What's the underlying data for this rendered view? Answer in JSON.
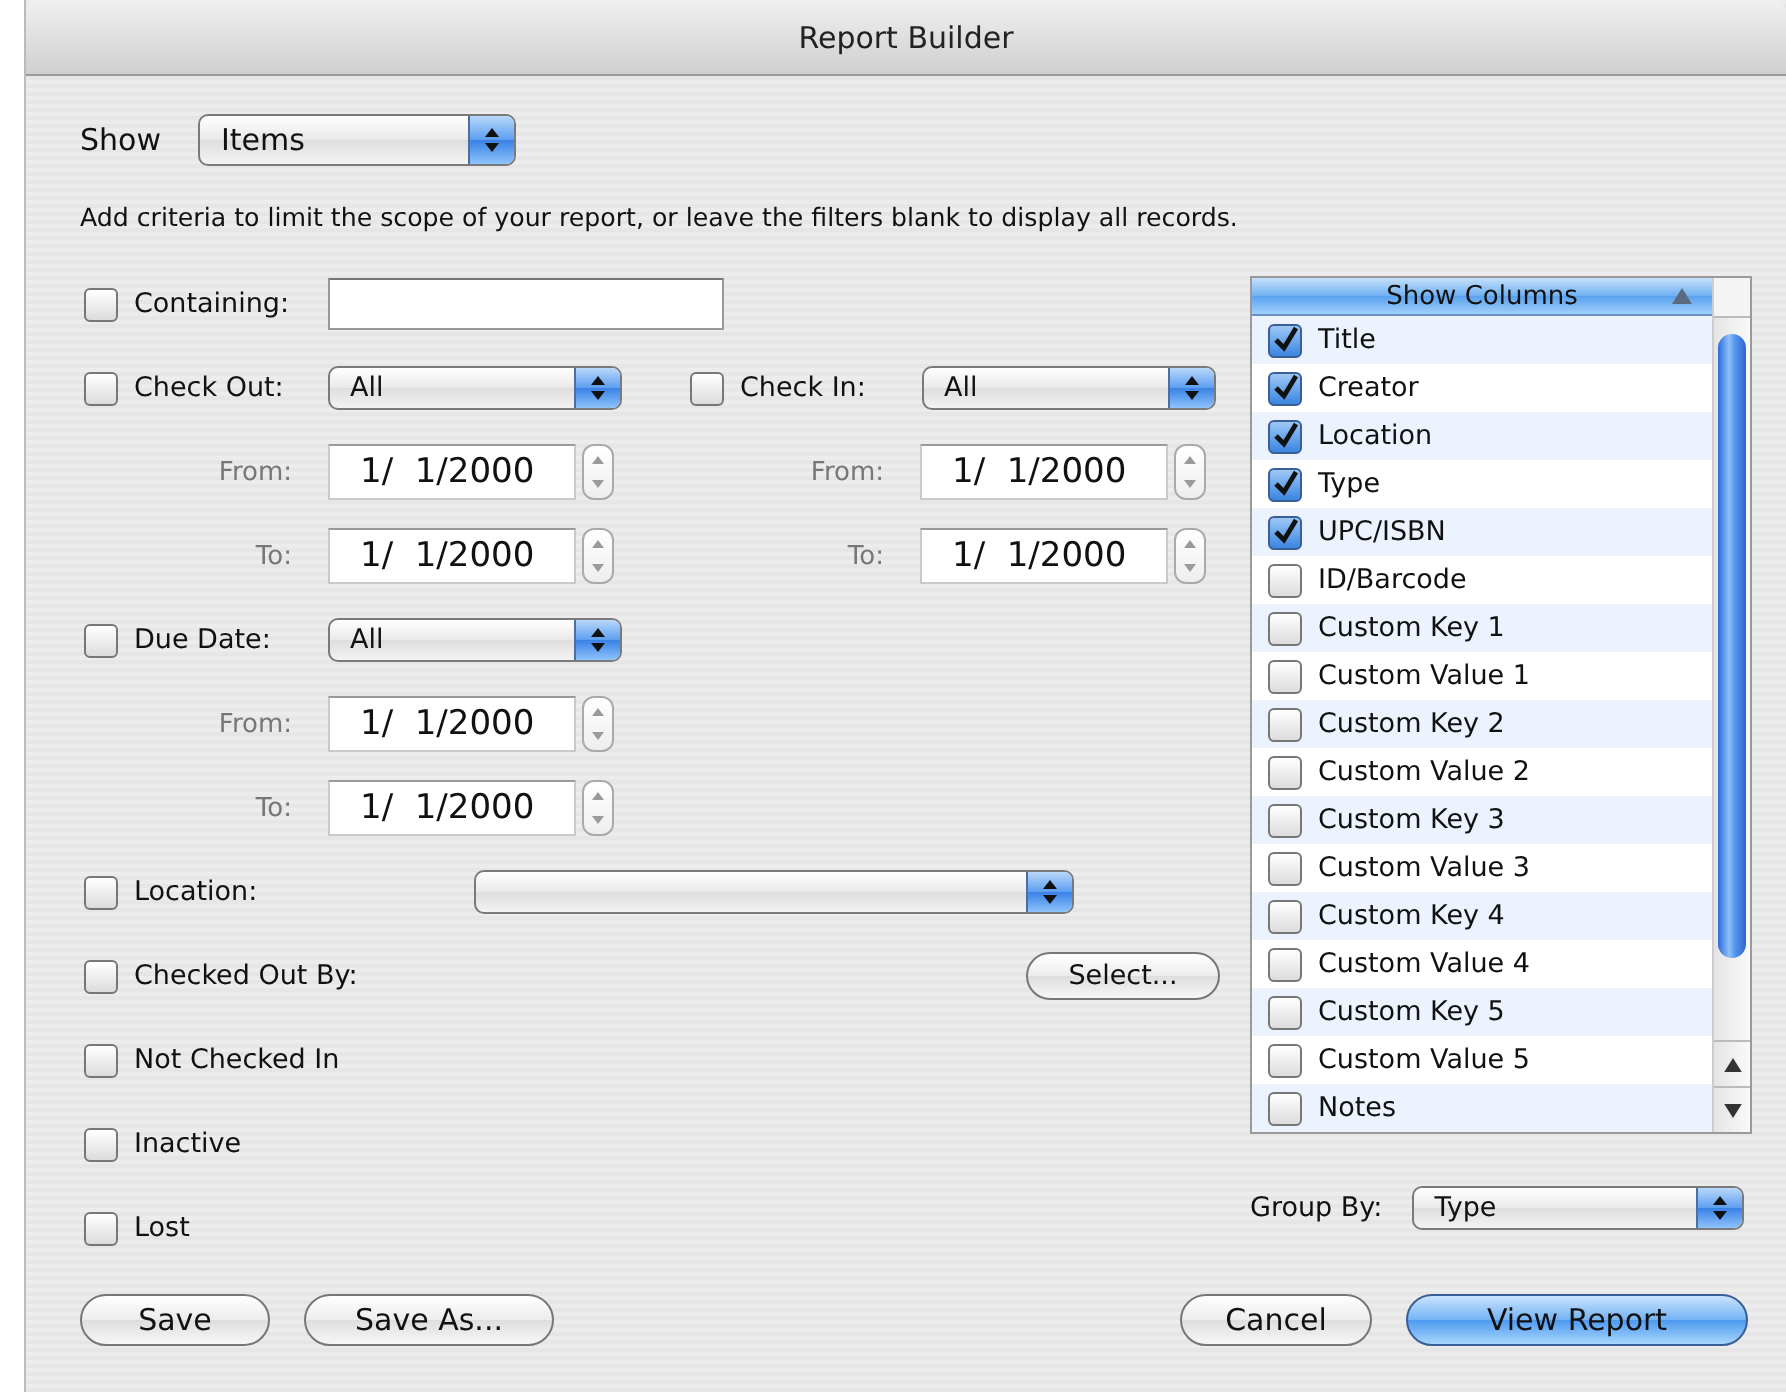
{
  "window": {
    "title": "Report Builder"
  },
  "show": {
    "label": "Show",
    "value": "Items"
  },
  "hint": "Add criteria to limit the scope of your report, or leave the filters blank to display all records.",
  "containing": {
    "label": "Containing:",
    "checked": false
  },
  "date_rows": [
    {
      "filters": [
        {
          "label": "Check Out:",
          "checked": false,
          "value": "All",
          "from_label": "From:",
          "from": "1/  1/2000",
          "to_label": "To:",
          "to": "1/  1/2000"
        },
        {
          "label": "Check In:",
          "checked": false,
          "value": "All",
          "from_label": "From:",
          "from": "1/  1/2000",
          "to_label": "To:",
          "to": "1/  1/2000"
        }
      ]
    },
    {
      "filters": [
        {
          "label": "Due Date:",
          "checked": false,
          "value": "All",
          "from_label": "From:",
          "from": "1/  1/2000",
          "to_label": "To:",
          "to": "1/  1/2000"
        }
      ]
    }
  ],
  "other_criteria": [
    {
      "kind": "popup",
      "label": "Location:",
      "checked": false
    },
    {
      "kind": "button",
      "label": "Checked Out By:",
      "checked": false,
      "button": "Select..."
    },
    {
      "kind": "flag",
      "label": "Not Checked In",
      "checked": false
    },
    {
      "kind": "flag",
      "label": "Inactive",
      "checked": false
    },
    {
      "kind": "flag",
      "label": "Lost",
      "checked": false
    }
  ],
  "columns": {
    "header": "Show Columns",
    "items": [
      {
        "label": "Title",
        "checked": true
      },
      {
        "label": "Creator",
        "checked": true
      },
      {
        "label": "Location",
        "checked": true
      },
      {
        "label": "Type",
        "checked": true
      },
      {
        "label": "UPC/ISBN",
        "checked": true
      },
      {
        "label": "ID/Barcode",
        "checked": false
      },
      {
        "label": "Custom Key 1",
        "checked": false
      },
      {
        "label": "Custom Value 1",
        "checked": false
      },
      {
        "label": "Custom Key 2",
        "checked": false
      },
      {
        "label": "Custom Value 2",
        "checked": false
      },
      {
        "label": "Custom Key 3",
        "checked": false
      },
      {
        "label": "Custom Value 3",
        "checked": false
      },
      {
        "label": "Custom Key 4",
        "checked": false
      },
      {
        "label": "Custom Value 4",
        "checked": false
      },
      {
        "label": "Custom Key 5",
        "checked": false
      },
      {
        "label": "Custom Value 5",
        "checked": false
      },
      {
        "label": "Notes",
        "checked": false
      }
    ]
  },
  "group_by": {
    "label": "Group By:",
    "value": "Type"
  },
  "buttons_left": [
    {
      "label": "Save",
      "kind": "normal"
    },
    {
      "label": "Save As...",
      "kind": "normal"
    }
  ],
  "buttons_right": [
    {
      "label": "Cancel",
      "kind": "normal"
    },
    {
      "label": "View Report",
      "kind": "default"
    }
  ]
}
